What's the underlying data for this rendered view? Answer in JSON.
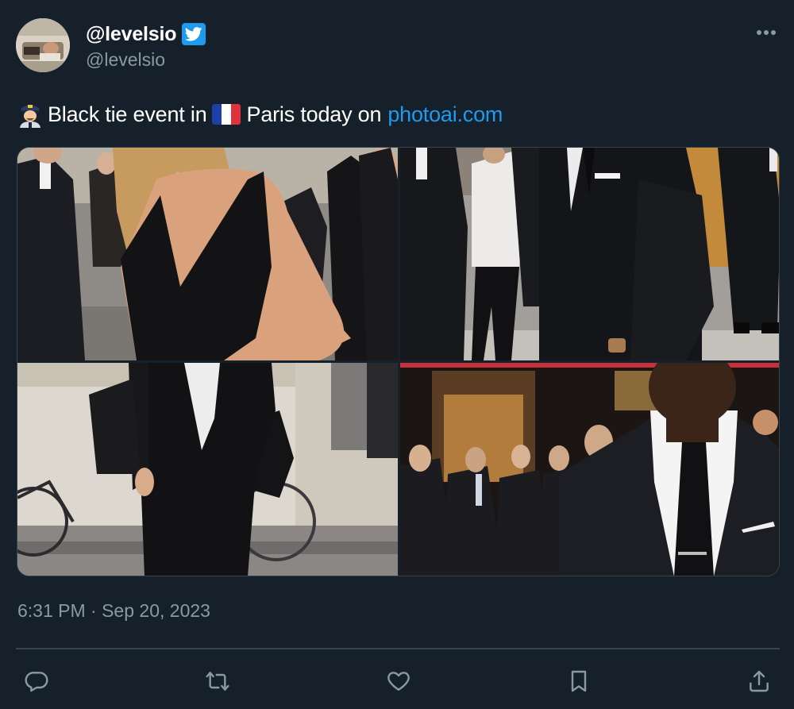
{
  "user": {
    "display_name": "@levelsio",
    "handle": "@levelsio",
    "verified": true
  },
  "tweet": {
    "text_part1": "Black tie event in",
    "text_part2": "Paris today on",
    "link_text": "photoai.com",
    "emoji_icon": "man-police-officer-emoji",
    "flag_icon": "france-flag-emoji"
  },
  "timestamp": "6:31 PM · Sep 20, 2023",
  "media": [
    {
      "name": "photo-woman-black-dress"
    },
    {
      "name": "photo-man-black-suit"
    },
    {
      "name": "photo-woman-black-suit-bag"
    },
    {
      "name": "photo-man-black-tie-closeup"
    }
  ],
  "actions": [
    "reply-icon",
    "retweet-icon",
    "like-icon",
    "bookmark-icon",
    "share-icon"
  ],
  "colors": {
    "background": "#15202b",
    "accent": "#1d9bf0",
    "secondary_text": "#8b98a5",
    "border": "#38444d"
  }
}
